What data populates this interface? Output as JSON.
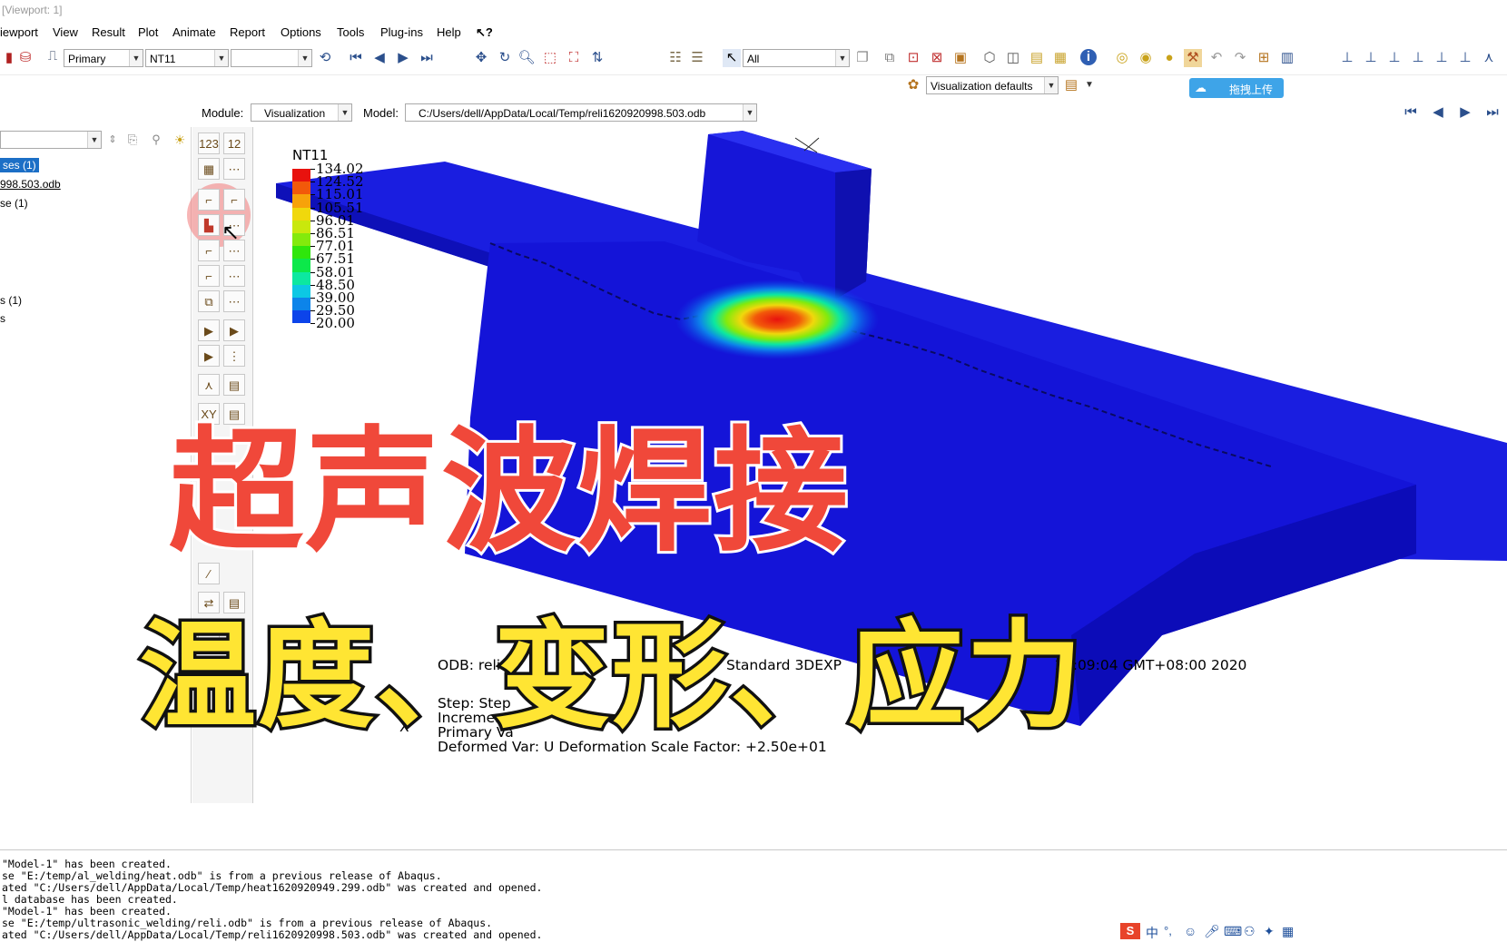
{
  "window": {
    "title": "[Viewport: 1]"
  },
  "menu": [
    "iewport",
    "View",
    "Result",
    "Plot",
    "Animate",
    "Report",
    "Options",
    "Tools",
    "Plug-ins",
    "Help"
  ],
  "help_cursor_icon": "help-pointer-icon",
  "toolbar": {
    "step_combo": "Primary",
    "field_combo": "NT11",
    "component_combo": "",
    "selection_combo": "All",
    "render_style_combo": "Visualization defaults",
    "upload_button": "拖拽上传"
  },
  "context": {
    "module_label": "Module:",
    "module_value": "Visualization",
    "model_label": "Model:",
    "model_value": "C:/Users/dell/AppData/Local/Temp/reli1620920998.503.odb"
  },
  "tree": {
    "items": [
      "ses (1)",
      "998.503.odb",
      "se (1)",
      "s (1)",
      "s"
    ]
  },
  "legend": {
    "title": "NT11",
    "labels": [
      "134.02",
      "124.52",
      "115.01",
      "105.51",
      "96.01",
      "86.51",
      "77.01",
      "67.51",
      "58.01",
      "48.50",
      "39.00",
      "29.50",
      "20.00"
    ],
    "colors": [
      "#e8120e",
      "#f2590a",
      "#f7a20a",
      "#f0d80c",
      "#c9e80c",
      "#83ea0c",
      "#2fe60c",
      "#0ce84a",
      "#0ce8a0",
      "#0cc8e4",
      "#0c84ea",
      "#0c44ea",
      "#0c12d8"
    ]
  },
  "info": {
    "line1_a": "ODB: reli",
    "line1_b": "Standard 3DEXP",
    "line1_c": "22:09:04 GMT+08:00 2020",
    "line2": "Step: Step",
    "line3": "Increment",
    "line4": "Primary Va",
    "line5": "Deformed Var: U   Deformation Scale Factor: +2.50e+01",
    "triad_x": "X"
  },
  "overlay": {
    "title": "超声波焊接",
    "subtitle": "温度、变形、应力"
  },
  "messages": [
    "\"Model-1\" has been created.",
    "se \"E:/temp/al_welding/heat.odb\" is from a previous release of Abaqus.",
    "ated \"C:/Users/dell/AppData/Local/Temp/heat1620920949.299.odb\" was created and opened.",
    "l database has been created.",
    "\"Model-1\" has been created.",
    "se \"E:/temp/ultrasonic_welding/reli.odb\" is from a previous release of Abaqus.",
    "ated \"C:/Users/dell/AppData/Local/Temp/reli1620920998.503.odb\" was created and opened."
  ],
  "ime": {
    "label": "中"
  }
}
